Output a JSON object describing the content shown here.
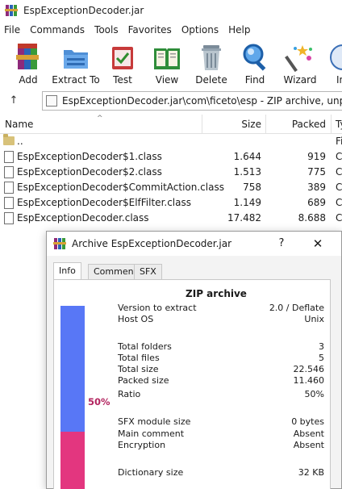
{
  "window": {
    "title": "EspExceptionDecoder.jar"
  },
  "menu": [
    "File",
    "Commands",
    "Tools",
    "Favorites",
    "Options",
    "Help"
  ],
  "toolbar": [
    {
      "label": "Add",
      "icon": "add-archive-icon"
    },
    {
      "label": "Extract To",
      "icon": "extract-to-icon"
    },
    {
      "label": "Test",
      "icon": "test-icon"
    },
    {
      "label": "View",
      "icon": "view-icon"
    },
    {
      "label": "Delete",
      "icon": "delete-icon"
    },
    {
      "label": "Find",
      "icon": "find-icon"
    },
    {
      "label": "Wizard",
      "icon": "wizard-icon"
    },
    {
      "label": "In",
      "icon": "info-icon"
    }
  ],
  "address": {
    "path": "EspExceptionDecoder.jar\\com\\ficeto\\esp - ZIP archive, unpacked"
  },
  "columns": {
    "name": "Name",
    "size": "Size",
    "packed": "Packed",
    "type": "Ty"
  },
  "files": [
    {
      "name": "..",
      "size": "",
      "packed": "",
      "type": "Fi",
      "is_folder": true
    },
    {
      "name": "EspExceptionDecoder$1.class",
      "size": "1.644",
      "packed": "919",
      "type": "C"
    },
    {
      "name": "EspExceptionDecoder$2.class",
      "size": "1.513",
      "packed": "775",
      "type": "C"
    },
    {
      "name": "EspExceptionDecoder$CommitAction.class",
      "size": "758",
      "packed": "389",
      "type": "C"
    },
    {
      "name": "EspExceptionDecoder$ElfFilter.class",
      "size": "1.149",
      "packed": "689",
      "type": "C"
    },
    {
      "name": "EspExceptionDecoder.class",
      "size": "17.482",
      "packed": "8.688",
      "type": "C"
    }
  ],
  "dialog": {
    "title": "Archive EspExceptionDecoder.jar",
    "help": "?",
    "close": "✕",
    "tabs": [
      "Info",
      "Comment",
      "SFX"
    ],
    "active_tab": "Info",
    "heading": "ZIP archive",
    "ratio_label": "50%",
    "ratio_value": 0.5,
    "fields": [
      {
        "key": "Version to extract",
        "value": "2.0 / Deflate"
      },
      {
        "key": "Host OS",
        "value": "Unix"
      },
      {
        "key": "Total folders",
        "value": "3"
      },
      {
        "key": "Total files",
        "value": "5"
      },
      {
        "key": "Total size",
        "value": "22.546"
      },
      {
        "key": "Packed size",
        "value": "11.460"
      },
      {
        "key": "Ratio",
        "value": "50%"
      },
      {
        "key": "SFX module size",
        "value": "0 bytes"
      },
      {
        "key": "Main comment",
        "value": "Absent"
      },
      {
        "key": "Encryption",
        "value": "Absent"
      },
      {
        "key": "Dictionary size",
        "value": "32 KB"
      }
    ]
  },
  "colors": {
    "ratio_packed": "#5877f6",
    "ratio_saved": "#e3367f"
  }
}
